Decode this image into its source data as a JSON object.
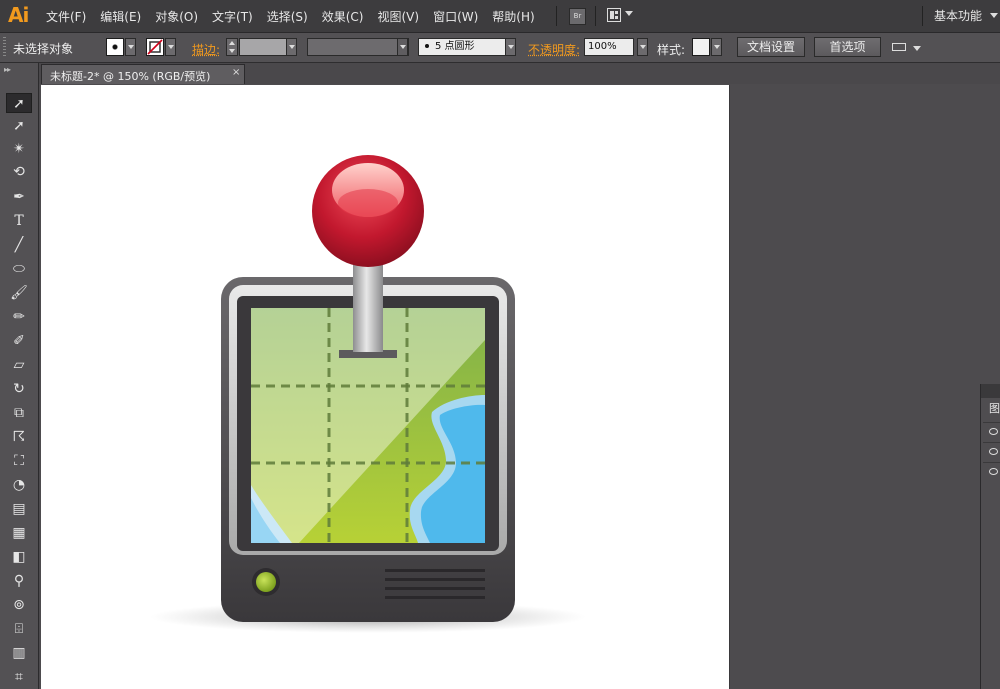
{
  "app": {
    "logo": "Ai"
  },
  "menu": {
    "items": [
      "文件(F)",
      "编辑(E)",
      "对象(O)",
      "文字(T)",
      "选择(S)",
      "效果(C)",
      "视图(V)",
      "窗口(W)",
      "帮助(H)"
    ],
    "bridge_label": "Br",
    "workspace": "基本功能"
  },
  "control": {
    "selection_status": "未选择对象",
    "stroke_label": "描边:",
    "brush": "5 点圆形",
    "opacity_label": "不透明度:",
    "opacity_value": "100%",
    "style_label": "样式:",
    "doc_setup": "文档设置",
    "preferences": "首选项"
  },
  "document": {
    "tab_title": "未标题-2* @ 150% (RGB/预览)",
    "close": "×"
  },
  "panel": {
    "tab_label": "图"
  },
  "colors": {
    "accent": "#f29a1e",
    "pin": "#c2182e",
    "map_green": "#9bc33c",
    "water": "#4fb9ec",
    "device": "#3f3d40"
  }
}
